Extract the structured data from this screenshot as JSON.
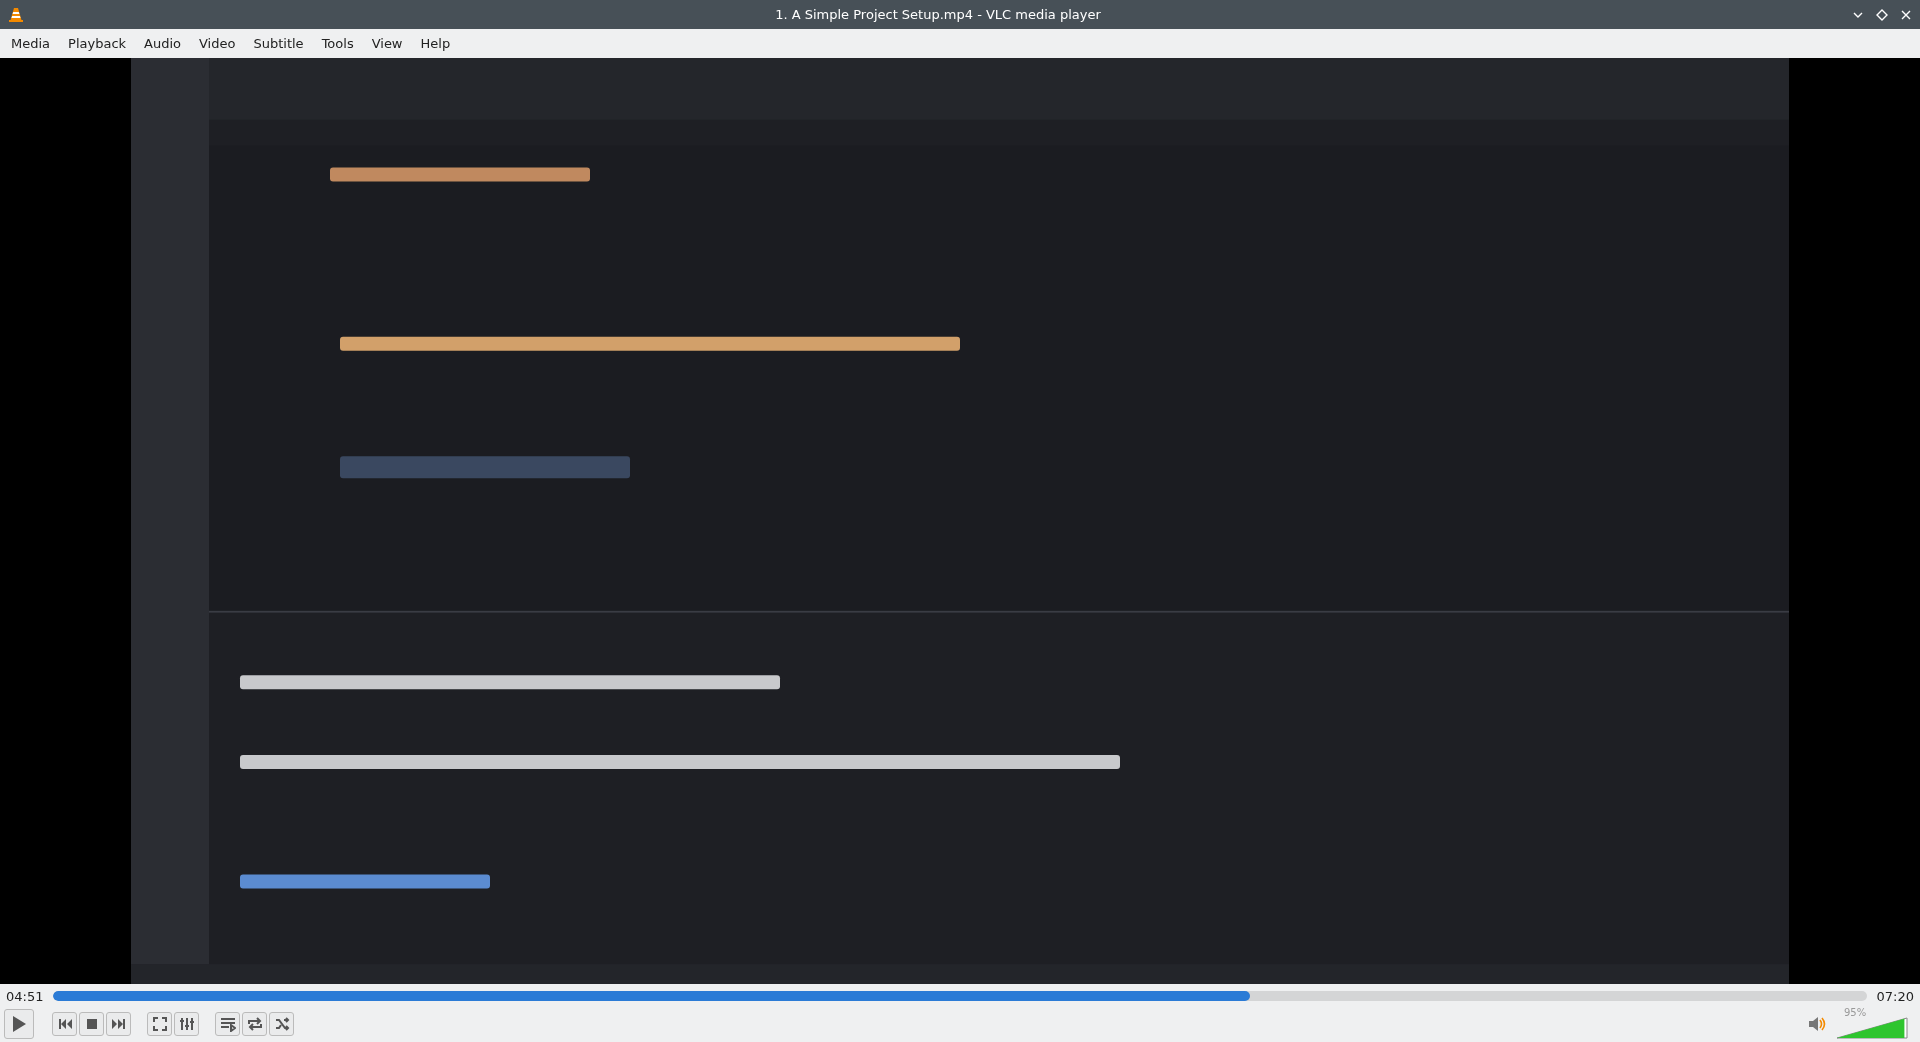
{
  "window": {
    "title": "1. A Simple Project Setup.mp4 - VLC media player"
  },
  "menu": [
    "Media",
    "Playback",
    "Audio",
    "Video",
    "Subtitle",
    "Tools",
    "View",
    "Help"
  ],
  "seek": {
    "elapsed": "04:51",
    "total": "07:20",
    "level": 0.66
  },
  "volume": {
    "reading": "95%",
    "level": 0.95
  }
}
